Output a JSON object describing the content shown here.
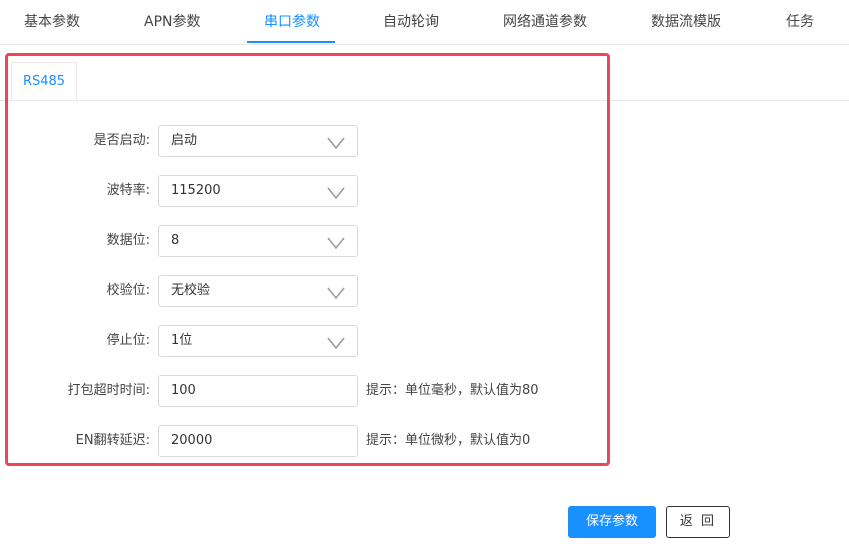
{
  "tabs": [
    {
      "label": "基本参数",
      "active": false
    },
    {
      "label": "APN参数",
      "active": false
    },
    {
      "label": "串口参数",
      "active": true
    },
    {
      "label": "自动轮询",
      "active": false
    },
    {
      "label": "网络通道参数",
      "active": false
    },
    {
      "label": "数据流模版",
      "active": false
    },
    {
      "label": "任务",
      "active": false
    }
  ],
  "subtabs": [
    {
      "label": "RS485"
    }
  ],
  "form": {
    "enabled": {
      "label": "是否启动:",
      "value": "启动"
    },
    "baud": {
      "label": "波特率:",
      "value": "115200"
    },
    "databits": {
      "label": "数据位:",
      "value": "8"
    },
    "parity": {
      "label": "校验位:",
      "value": "无校验"
    },
    "stopbits": {
      "label": "停止位:",
      "value": "1位"
    },
    "pack_timeout": {
      "label": "打包超时时间:",
      "value": "100",
      "hint": "提示：单位毫秒，默认值为80"
    },
    "en_delay": {
      "label": "EN翻转延迟:",
      "value": "20000",
      "hint": "提示：单位微秒，默认值为0"
    }
  },
  "buttons": {
    "save": "保存参数",
    "back": "返 回"
  },
  "colors": {
    "accent": "#1890ff",
    "highlight": "#e9485a"
  }
}
